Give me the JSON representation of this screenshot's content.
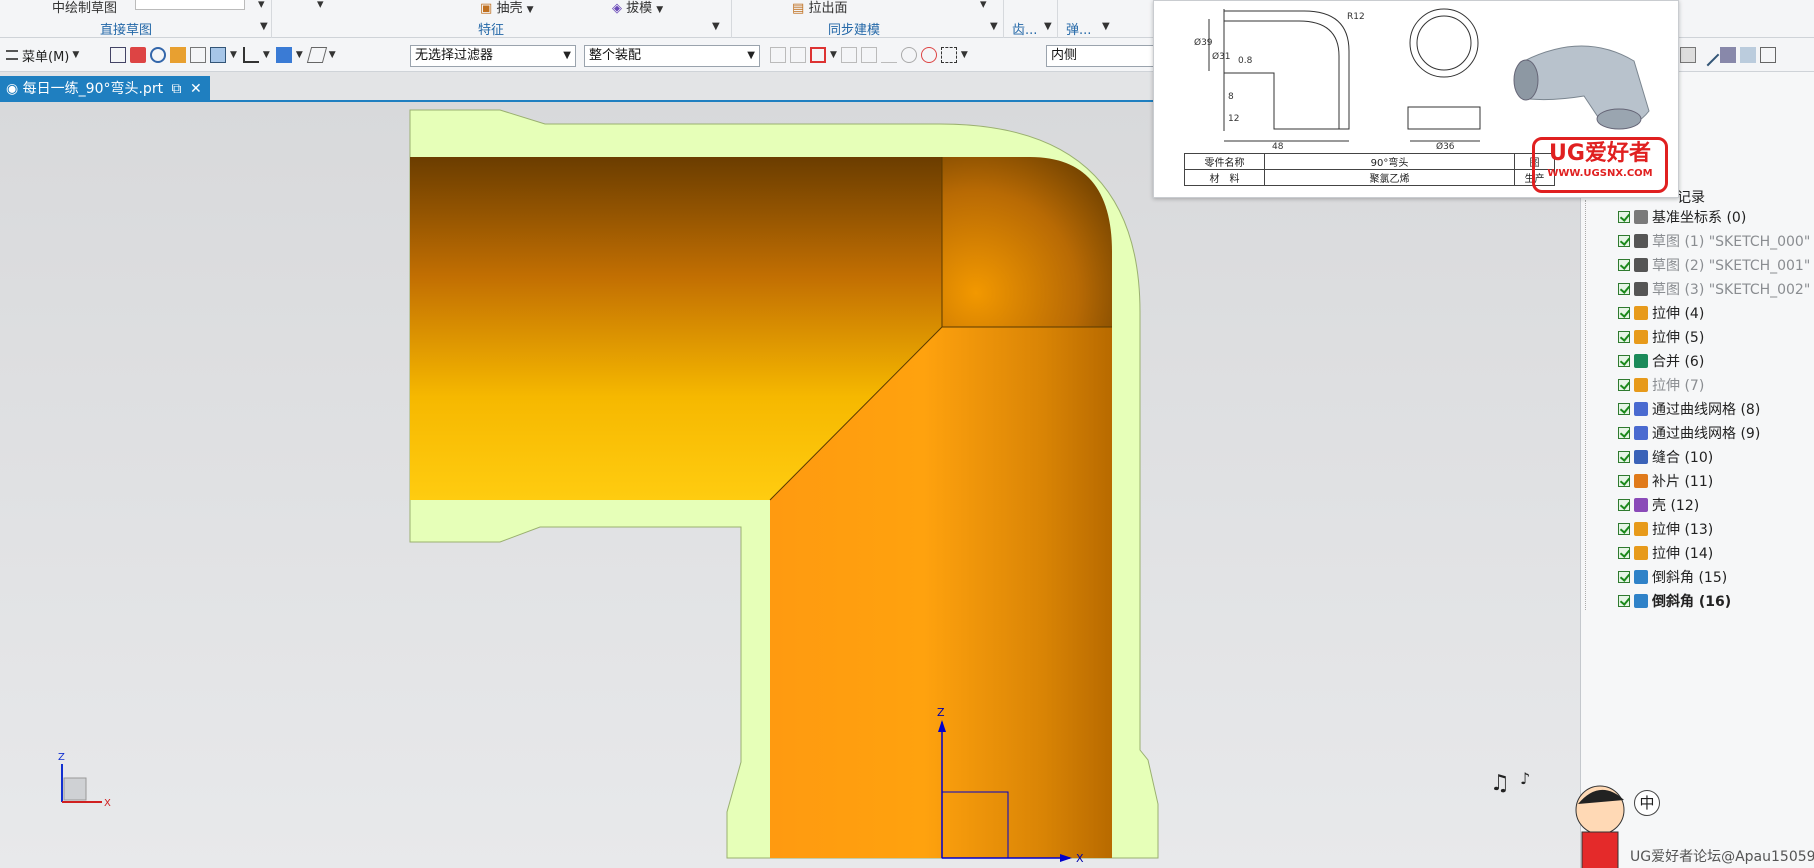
{
  "ribbon": {
    "sketch_cmd": "中绘制草图",
    "group_direct_sketch": "直接草图",
    "cmd_shell": "抽壳",
    "cmd_draft": "拔模",
    "group_feature": "特征",
    "cmd_extrude_face": "拉出面",
    "group_sync_modeling": "同步建模",
    "group_gear": "齿...",
    "group_spring": "弹..."
  },
  "toolbar": {
    "menu_label": "菜单(M)",
    "filter_value": "无选择过滤器",
    "assembly_value": "整个装配",
    "scope_value": "内侧"
  },
  "tab": {
    "title": "每日一练_90°弯头.prt"
  },
  "viewport": {
    "csys_z": "Z",
    "csys_x": "X",
    "triad_z": "Z",
    "triad_x": "X"
  },
  "navigator": {
    "header": "记录",
    "items": [
      {
        "label": "基准坐标系 (0)",
        "icon": "datum-csys-icon",
        "grey": false,
        "bold": false
      },
      {
        "label": "草图 (1) \"SKETCH_000\"",
        "icon": "sketch-icon",
        "grey": true,
        "bold": false
      },
      {
        "label": "草图 (2) \"SKETCH_001\"",
        "icon": "sketch-icon",
        "grey": true,
        "bold": false
      },
      {
        "label": "草图 (3) \"SKETCH_002\"",
        "icon": "sketch-icon",
        "grey": true,
        "bold": false
      },
      {
        "label": "拉伸 (4)",
        "icon": "extrude-icon",
        "grey": false,
        "bold": false
      },
      {
        "label": "拉伸 (5)",
        "icon": "extrude-icon",
        "grey": false,
        "bold": false
      },
      {
        "label": "合并 (6)",
        "icon": "unite-icon",
        "grey": false,
        "bold": false
      },
      {
        "label": "拉伸 (7)",
        "icon": "extrude-icon",
        "grey": true,
        "bold": false
      },
      {
        "label": "通过曲线网格 (8)",
        "icon": "curve-mesh-icon",
        "grey": false,
        "bold": false
      },
      {
        "label": "通过曲线网格 (9)",
        "icon": "curve-mesh-icon",
        "grey": false,
        "bold": false
      },
      {
        "label": "缝合 (10)",
        "icon": "sew-icon",
        "grey": false,
        "bold": false
      },
      {
        "label": "补片 (11)",
        "icon": "patch-icon",
        "grey": false,
        "bold": false
      },
      {
        "label": "壳 (12)",
        "icon": "shell-icon",
        "grey": false,
        "bold": false
      },
      {
        "label": "拉伸 (13)",
        "icon": "extrude-icon",
        "grey": false,
        "bold": false
      },
      {
        "label": "拉伸 (14)",
        "icon": "extrude-icon",
        "grey": false,
        "bold": false
      },
      {
        "label": "倒斜角 (15)",
        "icon": "chamfer-icon",
        "grey": false,
        "bold": false
      },
      {
        "label": "倒斜角 (16)",
        "icon": "chamfer-icon",
        "grey": false,
        "bold": true
      }
    ]
  },
  "drawing": {
    "part_name_label": "零件名称",
    "part_name_value": "90°弯头",
    "figure_label": "图",
    "material_label": "材　料",
    "material_value": "聚氯乙烯",
    "production_label": "生产",
    "dim_r12": "R12",
    "dim_d39": "Ø39",
    "dim_d31": "Ø31",
    "dim_08": "0.8",
    "dim_48": "48",
    "dim_12": "12",
    "dim_d36": "Ø36",
    "dim_8": "8",
    "stamp_title": "UG爱好者",
    "stamp_url": "WWW.UGSNX.COM"
  },
  "overlay": {
    "watermark": "UG爱好者论坛@Apau15059",
    "zhong_button": "中"
  },
  "colors": {
    "accent": "#1f7fc0",
    "section_face": "#e6ffb8",
    "orange_light": "#ffc30a",
    "orange_dark": "#c06c00",
    "stamp_red": "#e02020"
  }
}
